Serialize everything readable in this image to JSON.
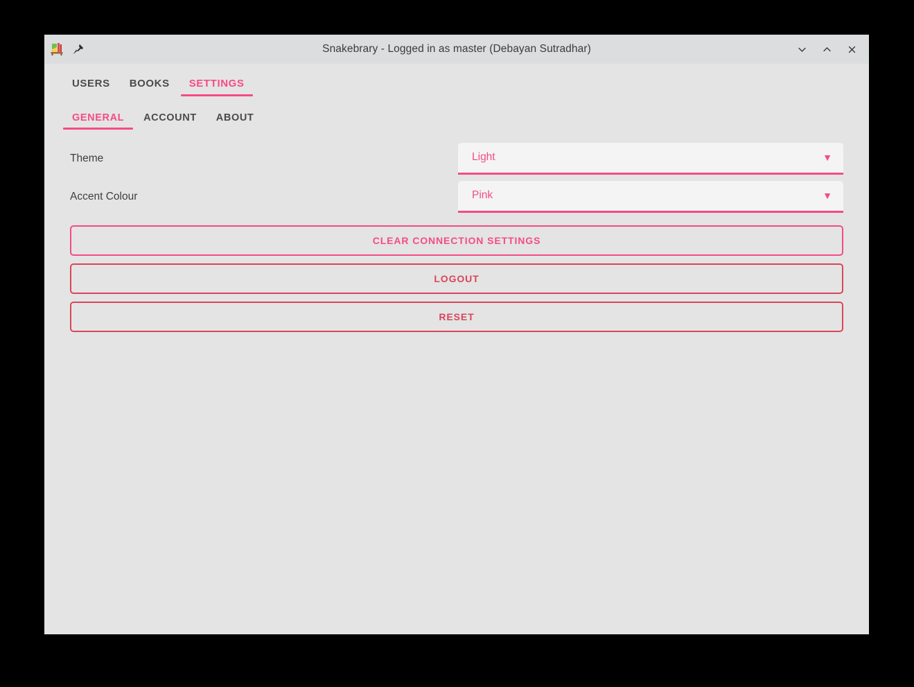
{
  "window": {
    "title": "Snakebrary - Logged in as master (Debayan Sutradhar)",
    "app_icon": "bookshelf-icon",
    "pin_icon": "pushpin-icon",
    "controls": {
      "minimize": "chevron-down-icon",
      "maximize": "chevron-up-icon",
      "close": "close-icon"
    }
  },
  "main_tabs": [
    {
      "label": "USERS",
      "active": false
    },
    {
      "label": "BOOKS",
      "active": false
    },
    {
      "label": "SETTINGS",
      "active": true
    }
  ],
  "sub_tabs": [
    {
      "label": "GENERAL",
      "active": true
    },
    {
      "label": "ACCOUNT",
      "active": false
    },
    {
      "label": "ABOUT",
      "active": false
    }
  ],
  "settings": {
    "theme": {
      "label": "Theme",
      "value": "Light",
      "arrow": "▼"
    },
    "accent_colour": {
      "label": "Accent Colour",
      "value": "Pink",
      "arrow": "▼"
    }
  },
  "actions": [
    {
      "label": "CLEAR CONNECTION SETTINGS",
      "style": "accent"
    },
    {
      "label": "LOGOUT",
      "style": "danger"
    },
    {
      "label": "RESET",
      "style": "danger"
    }
  ],
  "colors": {
    "accent": "#f54b87",
    "danger": "#d9455a",
    "titlebar_bg": "#dcdddf",
    "window_bg": "#e4e4e4",
    "field_bg": "#f4f4f4",
    "text": "#3f3f3f",
    "tab_inactive": "#4a4a4a",
    "desktop_bg": "#000000"
  }
}
